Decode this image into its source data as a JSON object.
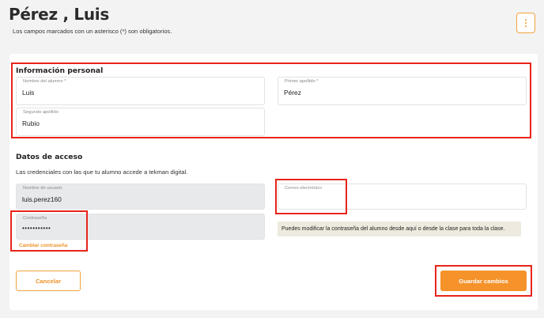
{
  "header": {
    "title": "Pérez , Luis",
    "subtitle": "Los campos marcados con un asterisco (*) son obligatorios.",
    "menu_icon": "more-vertical-icon",
    "menu_glyph": "⋮"
  },
  "personal": {
    "title": "Información personal",
    "first_name": {
      "label": "Nombre del alumno *",
      "value": "Luis"
    },
    "last_name": {
      "label": "Primer apellido *",
      "value": "Pérez"
    },
    "second_last_name": {
      "label": "Segundo apellido",
      "value": "Rubio"
    }
  },
  "access": {
    "title": "Datos de acceso",
    "description": "Las credenciales con las que tu alumno accede a tekman digital.",
    "username": {
      "label": "Nombre de usuario",
      "value": "luis.perez160"
    },
    "email": {
      "label": "Correo electrónico",
      "value": ""
    },
    "password": {
      "label": "Contraseña",
      "value": "•••••••••••"
    },
    "note": "Puedes modificar la contraseña del alumno desde aquí o desde la clase para toda la clase.",
    "change_password_link": "Cambiar contraseña"
  },
  "actions": {
    "cancel_label": "Cancelar",
    "save_label": "Guardar cambios"
  },
  "colors": {
    "accent": "#f5922a",
    "highlight": "#e8241a",
    "note_bg": "#eeeadf"
  }
}
